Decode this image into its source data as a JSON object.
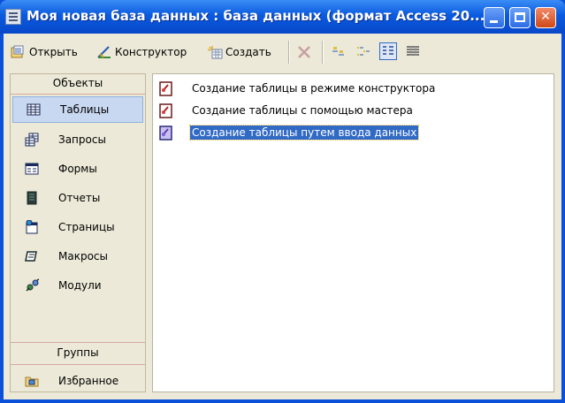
{
  "window": {
    "title": "Моя новая база данных : база данных (формат Access 20...",
    "accent": "#0a5ae0",
    "controls": {
      "minimize": "minimize",
      "maximize": "maximize",
      "close": "close"
    }
  },
  "toolbar": {
    "open_label": "Открыть",
    "design_label": "Конструктор",
    "create_label": "Создать",
    "icons": [
      "open-icon",
      "design-icon",
      "new-icon",
      "delete-icon",
      "large-icons-view",
      "small-icons-view",
      "list-view",
      "details-view"
    ]
  },
  "objects_panel": {
    "header": "Объекты",
    "items": [
      {
        "label": "Таблицы",
        "icon": "table-icon",
        "selected": true
      },
      {
        "label": "Запросы",
        "icon": "query-icon",
        "selected": false
      },
      {
        "label": "Формы",
        "icon": "form-icon",
        "selected": false
      },
      {
        "label": "Отчеты",
        "icon": "report-icon",
        "selected": false
      },
      {
        "label": "Страницы",
        "icon": "page-icon",
        "selected": false
      },
      {
        "label": "Макросы",
        "icon": "macro-icon",
        "selected": false
      },
      {
        "label": "Модули",
        "icon": "module-icon",
        "selected": false
      }
    ],
    "groups_header": "Группы",
    "groups": [
      {
        "label": "Избранное",
        "icon": "favorites-folder-icon"
      }
    ]
  },
  "content_list": {
    "items": [
      {
        "label": "Создание таблицы в режиме конструктора",
        "icon": "shortcut-design-icon",
        "selected": false
      },
      {
        "label": "Создание таблицы с помощью мастера",
        "icon": "shortcut-wizard-icon",
        "selected": false
      },
      {
        "label": "Создание таблицы путем ввода данных",
        "icon": "shortcut-datasheet-icon",
        "selected": true
      }
    ]
  },
  "colors": {
    "selection": "#316ac5",
    "panel_bg": "#ece9d8",
    "selected_item_bg": "#c8d8f0"
  }
}
